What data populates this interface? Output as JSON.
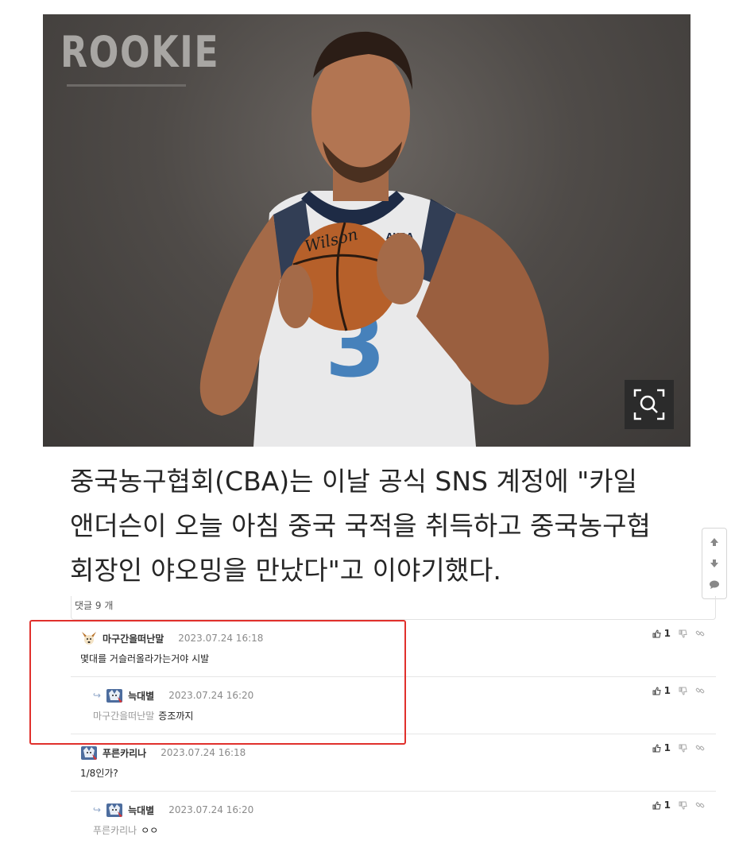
{
  "photo": {
    "logo_text": "ROOKIE",
    "jersey_text": "AURA",
    "ball_brand": "Wilson",
    "zoom_icon": "magnifier-in-frame-icon"
  },
  "article": {
    "lines": [
      "중국농구협회(CBA)는 이날 공식 SNS 계정에 \"카일",
      "앤더슨이 오늘 아침 중국 국적을 취득하고 중국농구협",
      "회장인 야오밍을 만났다\"고 이야기했다."
    ]
  },
  "float_tools": {
    "icons": [
      "arrow-up-icon",
      "arrow-down-icon",
      "chat-bubble-icon"
    ]
  },
  "comments_header": {
    "label": "댓글 9 개"
  },
  "comments": [
    {
      "nickname": "마구간을떠난말",
      "date": "2023.07.24 16:18",
      "text": "몇대를 거슬러올라가는거야 시발",
      "mention": "",
      "likes": "1"
    },
    {
      "nickname": "늑대별",
      "date": "2023.07.24 16:20",
      "text": "증조까지",
      "mention": "마구간을떠난말",
      "likes": "1"
    },
    {
      "nickname": "푸른카리나",
      "date": "2023.07.24 16:18",
      "text": "1/8인가?",
      "mention": "",
      "likes": "1"
    },
    {
      "nickname": "늑대별",
      "date": "2023.07.24 16:20",
      "text": "ㅇㅇ",
      "mention": "푸른카리나",
      "likes": "1"
    }
  ],
  "colors": {
    "highlight": "#e0302c",
    "reply_arrow": "#8fa7c8"
  }
}
